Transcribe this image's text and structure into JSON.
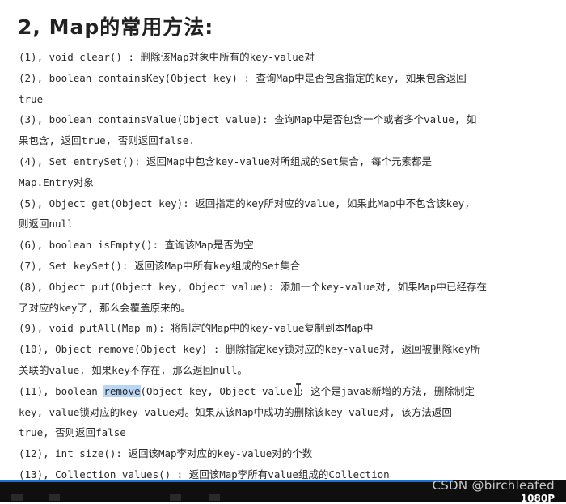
{
  "heading": "2, Map的常用方法:",
  "lines": [
    "(1), void clear() : 删除该Map对象中所有的key-value对",
    "(2), boolean containsKey(Object key) : 查询Map中是否包含指定的key, 如果包含返回",
    "true",
    "(3), boolean containsValue(Object value): 查询Map中是否包含一个或者多个value, 如",
    "果包含, 返回true, 否则返回false.",
    "(4), Set entrySet(): 返回Map中包含key-value对所组成的Set集合, 每个元素都是",
    "Map.Entry对象",
    "(5), Object get(Object key): 返回指定的key所对应的value, 如果此Map中不包含该key,",
    "则返回null",
    "(6), boolean isEmpty(): 查询该Map是否为空",
    "(7), Set keySet(): 返回该Map中所有key组成的Set集合",
    "(8), Object put(Object key, Object value): 添加一个key-value对, 如果Map中已经存在",
    "了对应的key了, 那么会覆盖原来的。",
    "(9), void putAll(Map m): 将制定的Map中的key-value复制到本Map中",
    "(10), Object remove(Object key) : 删除指定key锁对应的key-value对, 返回被删除key所",
    "关联的value, 如果key不存在, 那么返回null。",
    {
      "before": "(11), boolean ",
      "highlight": "remove",
      "after": "(Object key, Object value): 这个是java8新增的方法, 删除制定"
    },
    "key, value锁对应的key-value对。如果从该Map中成功的删除该key-value对, 该方法返回",
    "true, 否则返回false",
    "(12), int size(): 返回该Map李对应的key-value对的个数",
    "(13), Collection values() : 返回该Map李所有value组成的Collection"
  ],
  "watermark": "CSDN @birchleafed",
  "quality_label": "1080P",
  "video_progress": 0.8,
  "colors": {
    "highlight": "#b9d6f5",
    "progress": "#1a6fd6",
    "bar": "#0f0f10"
  },
  "icons": [
    "text-cursor-icon"
  ]
}
